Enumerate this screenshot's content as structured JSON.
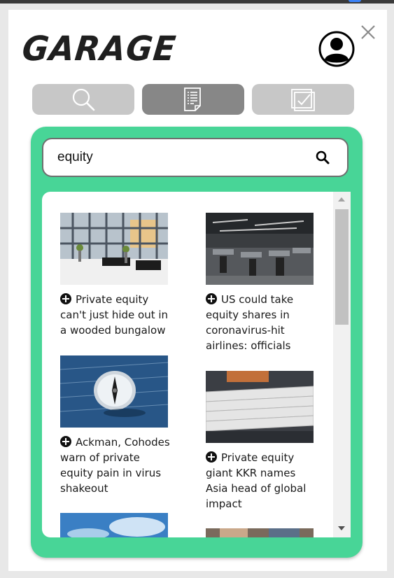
{
  "app": {
    "logo_text": "GARAGE"
  },
  "search": {
    "query": "equity",
    "placeholder": ""
  },
  "tabs": [
    {
      "name": "search",
      "icon": "magnifier-icon",
      "active": false
    },
    {
      "name": "articles",
      "icon": "document-list-icon",
      "active": true
    },
    {
      "name": "tasks",
      "icon": "checkbox-icon",
      "active": false
    }
  ],
  "results": [
    {
      "title": "Private equity can't just hide out in a wooded bungalow",
      "image": "office-lobby-photo"
    },
    {
      "title": "US could take equity shares in coronavirus-hit airlines: officials",
      "image": "open-office-photo"
    },
    {
      "title": "Ackman, Cohodes warn of private equity pain in virus shakeout",
      "image": "compass-on-newspaper-photo"
    },
    {
      "title": "Private equity giant KKR names Asia head of global impact",
      "image": "newspaper-stack-photo"
    },
    {
      "title": "",
      "image": "sky-photo"
    },
    {
      "title": "",
      "image": "people-photo"
    }
  ],
  "colors": {
    "accent": "#48d597",
    "tab_inactive": "#c7c7c7",
    "tab_active": "#878787"
  }
}
